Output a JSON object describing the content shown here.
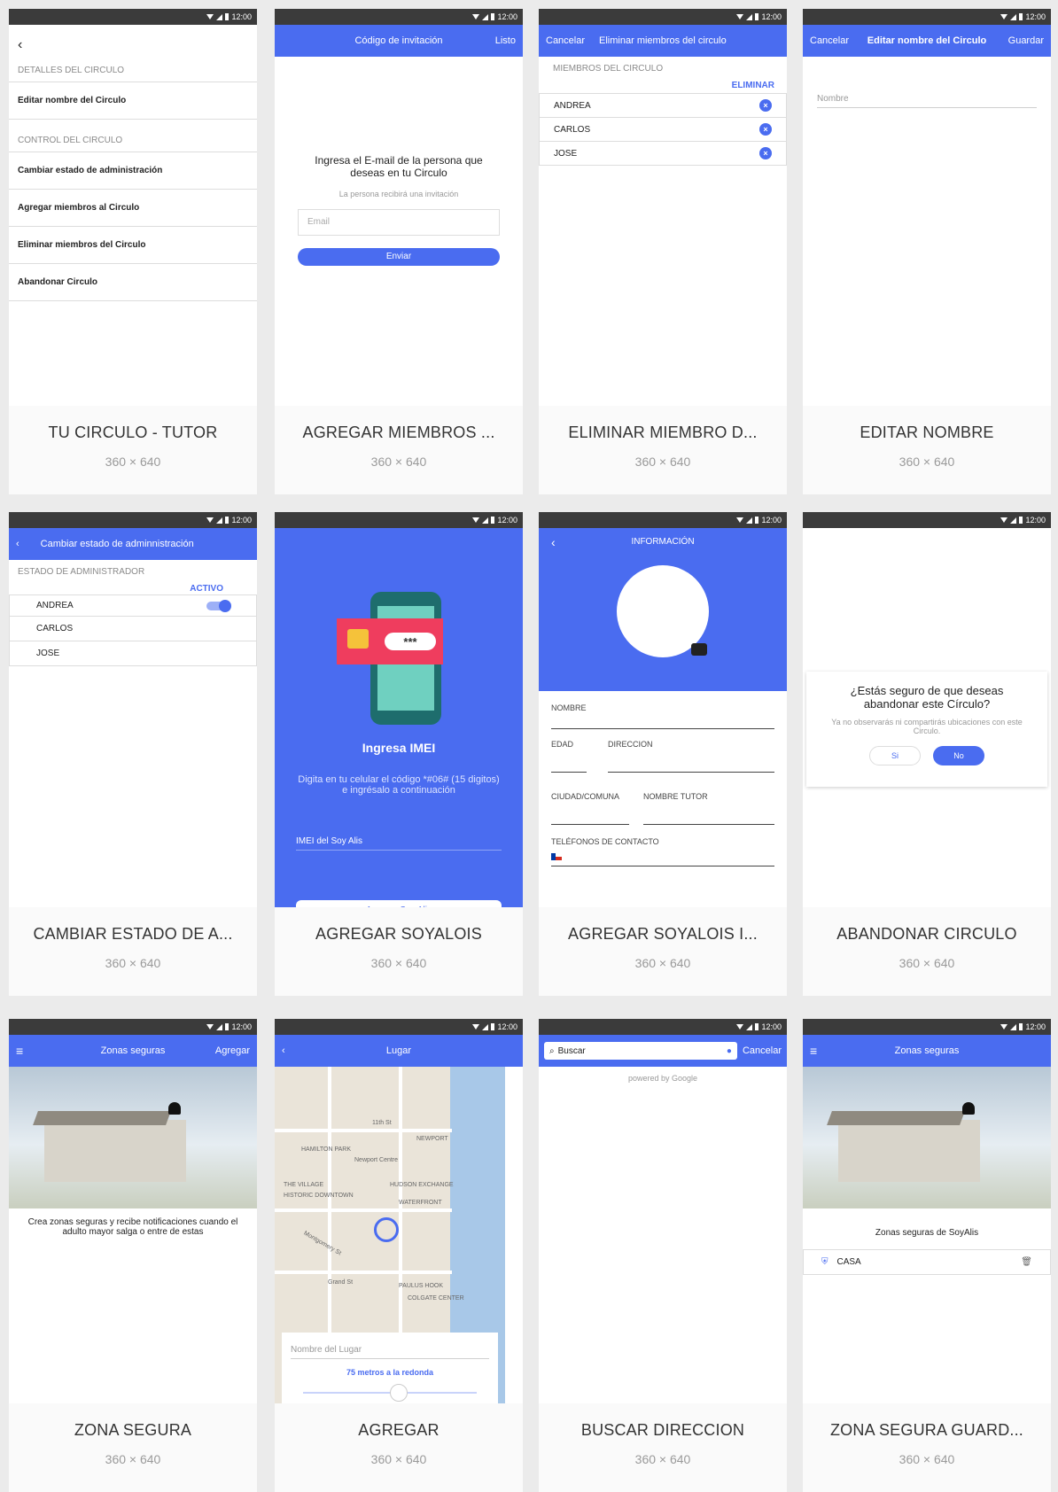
{
  "status_time": "12:00",
  "screens": [
    {
      "title": "TU CIRCULO - TUTOR",
      "size": "360 × 640",
      "section1": "DETALLES DEL CIRCULO",
      "row_edit": "Editar nombre del Circulo",
      "section2": "CONTROL DEL CIRCULO",
      "rows": [
        "Cambiar estado de administración",
        "Agregar miembros al Circulo",
        "Eliminar miembros del Circulo",
        "Abandonar Circulo"
      ]
    },
    {
      "title": "AGREGAR MIEMBROS ...",
      "size": "360 × 640",
      "bar_title": "Código de invitación",
      "bar_right": "Listo",
      "heading": "Ingresa el E-mail de la persona que deseas en tu Circulo",
      "sub": "La persona recibirá una invitación",
      "email_placeholder": "Email",
      "send": "Enviar"
    },
    {
      "title": "ELIMINAR MIEMBRO D...",
      "size": "360 × 640",
      "bar_left": "Cancelar",
      "bar_title": "Eliminar miembros del circulo",
      "section": "MIEMBROS DEL CIRCULO",
      "action": "ELIMINAR",
      "members": [
        "ANDREA",
        "CARLOS",
        "JOSE"
      ]
    },
    {
      "title": "EDITAR NOMBRE",
      "size": "360 × 640",
      "bar_left": "Cancelar",
      "bar_title": "Editar nombre del Circulo",
      "bar_right": "Guardar",
      "field": "Nombre"
    },
    {
      "title": "CAMBIAR ESTADO DE A...",
      "size": "360 × 640",
      "bar_title": "Cambiar estado de adminnistración",
      "section": "ESTADO DE ADMINISTRADOR",
      "active": "ACTIVO",
      "members": [
        "ANDREA",
        "CARLOS",
        "JOSE"
      ]
    },
    {
      "title": "AGREGAR SOYALOIS",
      "size": "360 × 640",
      "password_mask": "***",
      "heading": "Ingresa IMEI",
      "desc": "Digita en tu celular el código *#06# (15 digitos) e ingrésalo a continuación",
      "field": "IMEI del Soy Alis",
      "button": "Agregar Soy Alis"
    },
    {
      "title": "AGREGAR SOYALOIS I...",
      "size": "360 × 640",
      "bar_title": "INFORMACIÓN",
      "f_nombre": "NOMBRE",
      "f_edad": "EDAD",
      "f_direccion": "DIRECCION",
      "f_ciudad": "CIUDAD/COMUNA",
      "f_tutor": "NOMBRE TUTOR",
      "f_telefonos": "TELÉFONOS DE CONTACTO"
    },
    {
      "title": "ABANDONAR CIRCULO",
      "size": "360 × 640",
      "question": "¿Estás seguro de que deseas abandonar este Círculo?",
      "note": "Ya no observarás ni compartirás ubicaciones con este Circulo.",
      "yes": "Si",
      "no": "No"
    },
    {
      "title": "ZONA SEGURA",
      "size": "360 × 640",
      "bar_title": "Zonas seguras",
      "bar_right": "Agregar",
      "desc": "Crea zonas seguras y recibe notificaciones cuando el adulto mayor salga o entre de estas"
    },
    {
      "title": "AGREGAR",
      "size": "360 × 640",
      "bar_title": "Lugar",
      "map_labels": [
        "HAMILTON PARK",
        "Newport Centre",
        "NEWPORT",
        "THE VILLAGE",
        "HISTORIC DOWNTOWN",
        "HUDSON EXCHANGE",
        "WATERFRONT",
        "Montgomery St",
        "Grand St",
        "PAULUS HOOK",
        "COLGATE CENTER",
        "11th St"
      ],
      "place_field": "Nombre del Lugar",
      "radius": "75 metros a la redonda"
    },
    {
      "title": "BUSCAR DIRECCION",
      "size": "360 × 640",
      "search": "Buscar",
      "cancel": "Cancelar",
      "powered": "powered by Google"
    },
    {
      "title": "ZONA SEGURA GUARD...",
      "size": "360 × 640",
      "bar_title": "Zonas seguras",
      "subtitle": "Zonas seguras de SoyAlis",
      "zone": "CASA"
    }
  ],
  "colors": {
    "primary": "#4a6cf0",
    "status_bar": "#3b3b3b",
    "lock_red": "#ef3d5e"
  }
}
